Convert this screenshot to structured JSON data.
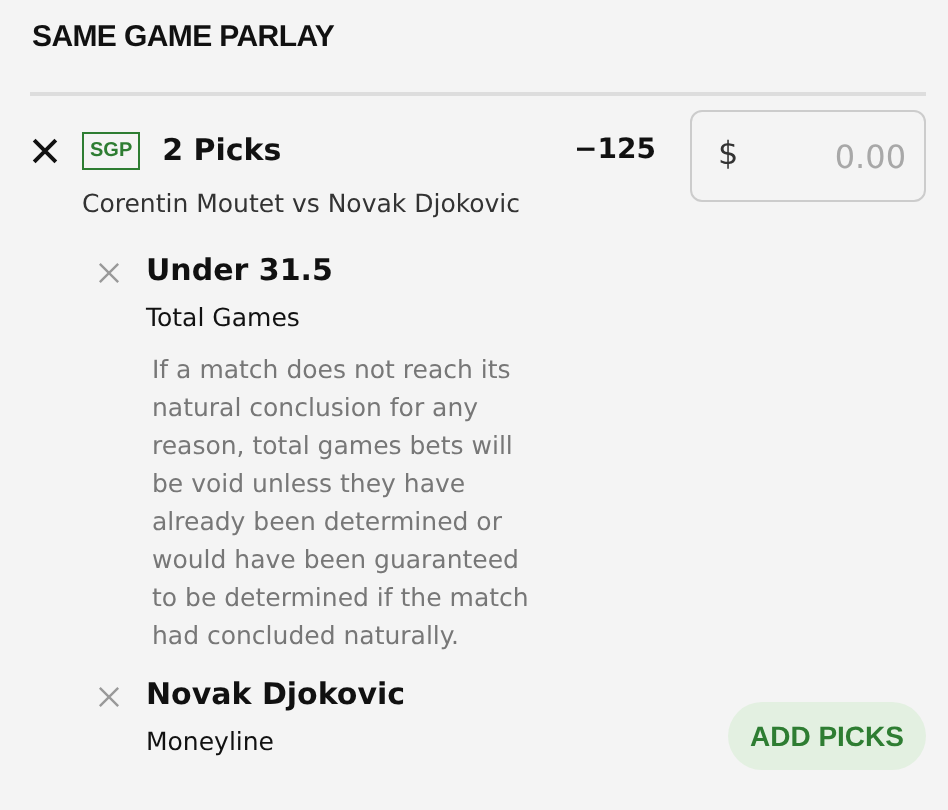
{
  "header": {
    "title": "SAME GAME PARLAY"
  },
  "parlay": {
    "badge": "SGP",
    "title": "2 Picks",
    "odds": "−125",
    "matchup": "Corentin Moutet vs Novak Djokovic",
    "stake": {
      "currency": "$",
      "placeholder": "0.00"
    }
  },
  "legs": [
    {
      "selection": "Under 31.5",
      "market": "Total Games",
      "note": "If a match does not reach its natural conclusion for any reason, total games bets will be void unless they have already been determined or would have been guaranteed to be determined if the match had concluded naturally."
    },
    {
      "selection": "Novak Djokovic",
      "market": "Moneyline"
    }
  ],
  "add_button": "ADD PICKS"
}
